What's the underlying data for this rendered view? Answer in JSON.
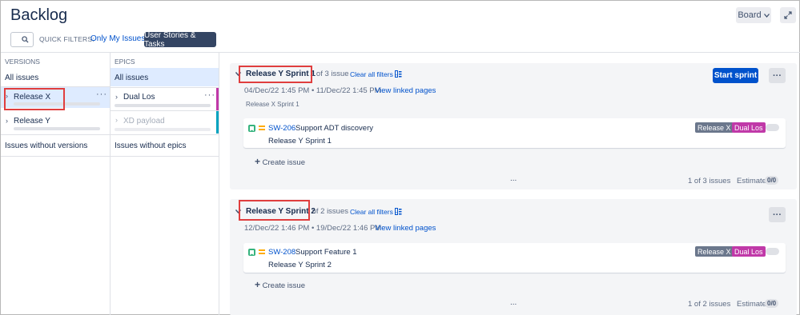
{
  "header": {
    "title": "Backlog",
    "board_label": "Board",
    "quick_filters_label": "QUICK FILTERS:",
    "filter_only_my": "Only My Issues",
    "filter_stories": "User Stories & Tasks"
  },
  "versions": {
    "heading": "VERSIONS",
    "all_issues": "All issues",
    "items": [
      {
        "label": "Release X"
      },
      {
        "label": "Release Y"
      }
    ],
    "without": "Issues without versions"
  },
  "epics": {
    "heading": "EPICS",
    "all_issues": "All issues",
    "items": [
      {
        "label": "Dual Los",
        "color": "#c039a8"
      },
      {
        "label": "XD payload",
        "color": "#00a3bf"
      }
    ],
    "without": "Issues without epics"
  },
  "sprints": [
    {
      "name": "Release Y Sprint 1",
      "count": "1 of 3 issues",
      "clear": "Clear all filters",
      "dates": "04/Dec/22 1:45 PM • 11/Dec/22 1:45 PM",
      "linked": "View linked pages",
      "goal": "Release X Sprint 1",
      "start_label": "Start sprint",
      "issue": {
        "key": "SW-206",
        "summary": "Support ADT discovery",
        "sprint": "Release Y Sprint 1",
        "version": "Release X",
        "epic": "Dual Los"
      },
      "create": "Create issue",
      "footer_count": "1 of 3 issues",
      "estimate_label": "Estimate",
      "estimate_value": "0/0"
    },
    {
      "name": "Release Y Sprint 2",
      "count": "2 of 2 issues",
      "clear": "Clear all filters",
      "dates": "12/Dec/22 1:46 PM • 19/Dec/22 1:46 PM",
      "linked": "View linked pages",
      "issue": {
        "key": "SW-208",
        "summary": "Support Feature 1",
        "sprint": "Release Y Sprint 2",
        "version": "Release X",
        "epic": "Dual Los"
      },
      "create": "Create issue",
      "footer_count": "1 of 2 issues",
      "estimate_label": "Estimate",
      "estimate_value": "0/0"
    }
  ],
  "colors": {
    "version_lozenge": "#6b778c",
    "epic_lozenge": "#c039a8",
    "primary": "#0052cc",
    "highlight": "#e03e3e"
  },
  "icons": {
    "more": "more-icon",
    "expand": "expand-icon",
    "search": "search-icon",
    "story": "story-icon",
    "priority": "priority-medium-icon"
  }
}
